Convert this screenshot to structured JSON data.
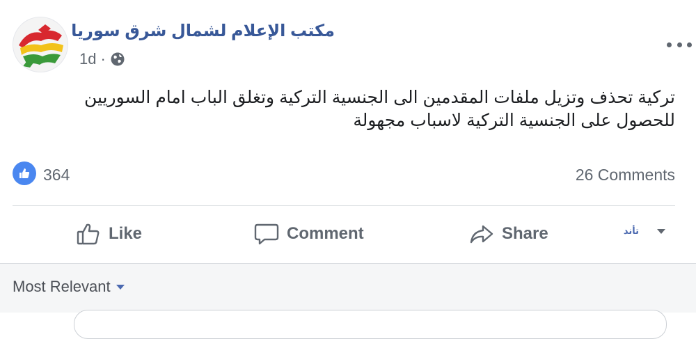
{
  "post": {
    "page_name": "مكتب الإعلام لشمال شرق سوريا",
    "time": "1d",
    "separator": "·",
    "privacy_icon": "globe-icon",
    "more_icon": "more-horizontal-icon",
    "text_line_1": "تركية تحذف وتزيل ملفات المقدمين الى الجنسية التركية وتغلق الباب امام السوريين",
    "text_line_2": "للحصول على الجنسية التركية لاسباب مجهولة"
  },
  "stats": {
    "reaction_icon": "like-reaction-icon",
    "like_count": "364",
    "comments_label": "26 Comments"
  },
  "actions": {
    "like_label": "Like",
    "comment_label": "Comment",
    "share_label": "Share",
    "audience_logo_text": "تأند"
  },
  "comments": {
    "sort_label": "Most Relevant"
  },
  "colors": {
    "page_name": "#385898",
    "secondary_text": "#606770",
    "like_badge": "#4a87f0",
    "divider": "#dadde1",
    "comments_bg": "#f5f6f7"
  }
}
